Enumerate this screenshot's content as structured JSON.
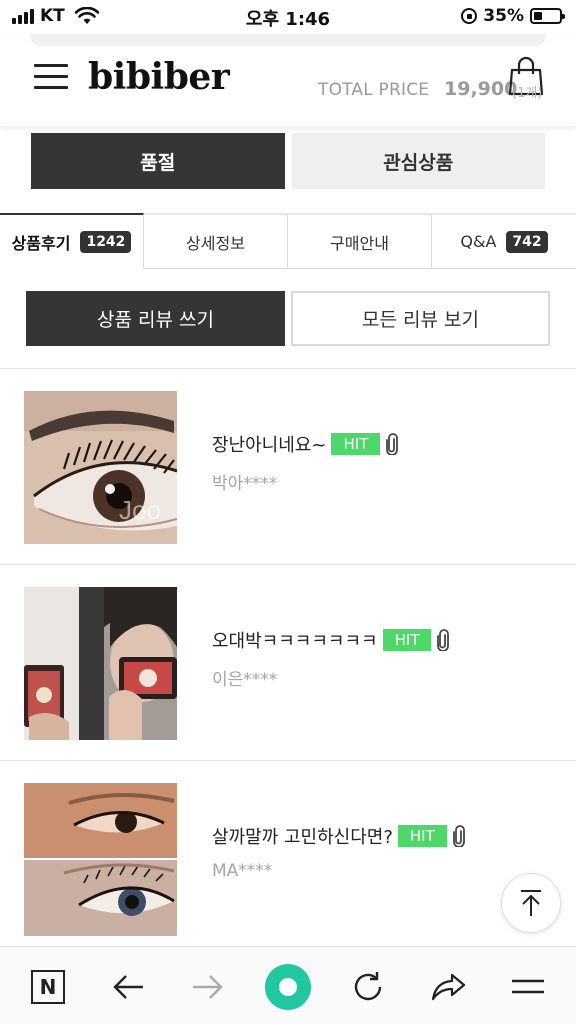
{
  "status_bar": {
    "carrier": "KT",
    "time": "오후 1:46",
    "battery": "35%",
    "battery_level": 0.35
  },
  "header": {
    "logo": "bibiber",
    "total_label": "TOTAL PRICE",
    "total_value": "19,900",
    "total_count": "(1개)"
  },
  "actions": {
    "soldout": "품절",
    "wishlist": "관심상품"
  },
  "tabs": [
    {
      "label": "상품후기",
      "badge": "1242"
    },
    {
      "label": "상세정보",
      "badge": ""
    },
    {
      "label": "구매안내",
      "badge": ""
    },
    {
      "label": "Q&A",
      "badge": "742"
    }
  ],
  "review_buttons": {
    "write": "상품 리뷰 쓰기",
    "all": "모든 리뷰 보기"
  },
  "reviews": [
    {
      "title": "장난아니네요~",
      "badge": "HIT",
      "author": "박아****"
    },
    {
      "title": "오대박ㅋㅋㅋㅋㅋㅋㅋ",
      "badge": "HIT",
      "author": "이은****"
    },
    {
      "title": "살까말까 고민하신다면?",
      "badge": "HIT",
      "author": "MA****"
    }
  ],
  "colors": {
    "dark_button": "#353535",
    "hit_badge": "#4ed86a",
    "accent_green": "#21c7a0"
  },
  "icons": {
    "menu": "hamburger-icon",
    "cart": "shopping-bag-icon",
    "attachment": "paperclip-icon",
    "scroll_top": "arrow-up-icon",
    "bottom_bar": [
      "naver-n-icon",
      "back-arrow-icon",
      "forward-arrow-icon",
      "home-circle-icon",
      "refresh-icon",
      "share-icon",
      "menu-icon"
    ]
  }
}
